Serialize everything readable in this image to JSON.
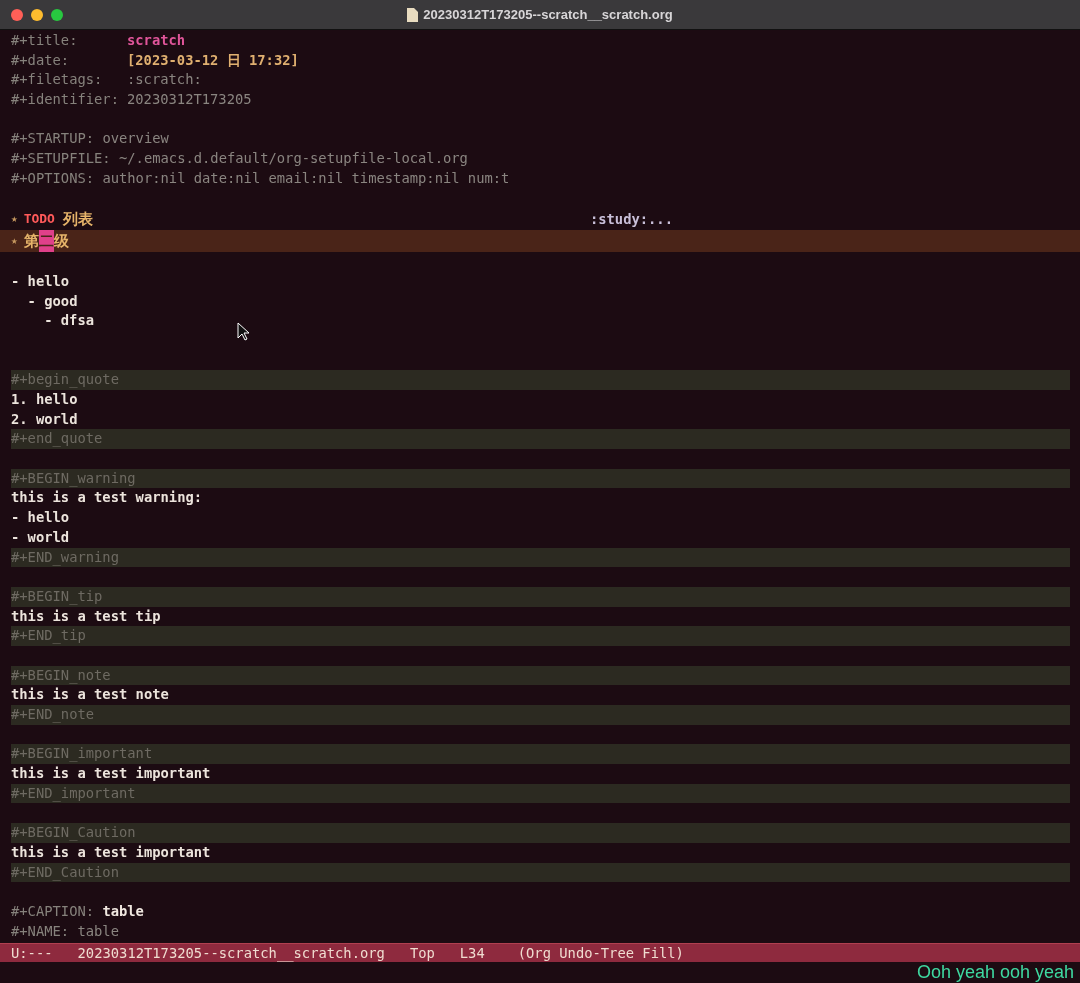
{
  "window": {
    "title": "20230312T173205--scratch__scratch.org"
  },
  "lines": [
    {
      "kind": "property",
      "key": "#+title:",
      "value": "scratch",
      "color": "#e0559a"
    },
    {
      "kind": "property",
      "key": "#+date:",
      "value": "[2023-03-12 日 17:32]",
      "color": "#e0b070"
    },
    {
      "kind": "property",
      "key": "#+filetags:",
      "value": ":scratch:",
      "color": "#8a8580"
    },
    {
      "kind": "property",
      "key": "#+identifier:",
      "value": "20230312T173205",
      "color": "#8a8580"
    },
    {
      "kind": "blank"
    },
    {
      "kind": "option",
      "key": "#+STARTUP:",
      "value": "overview",
      "color": "#8a8580"
    },
    {
      "kind": "option",
      "key": "#+SETUPFILE:",
      "value": "~/.emacs.d.default/org-setupfile-local.org",
      "color": "#8a8580"
    },
    {
      "kind": "option",
      "key": "#+OPTIONS:",
      "value": "author:nil date:nil email:nil timestamp:nil num:t",
      "color": "#8a8580"
    },
    {
      "kind": "blank"
    },
    {
      "kind": "heading",
      "star": "★",
      "todo": "TODO",
      "text": "列表",
      "tags": ":study:...",
      "current": false
    },
    {
      "kind": "heading",
      "star": "★",
      "text": "第",
      "cursor": "二",
      "rest": "级",
      "current": true
    },
    {
      "kind": "blank"
    },
    {
      "kind": "list",
      "items": [
        {
          "text": "- hello",
          "children": [
            {
              "text": "- good",
              "children": [
                {
                  "text": "- dfsa"
                }
              ]
            }
          ]
        }
      ]
    },
    {
      "kind": "blank"
    },
    {
      "kind": "blank"
    },
    {
      "kind": "block",
      "begin": "#+begin_quote",
      "body": [
        "1. hello",
        "2. world"
      ],
      "end": "#+end_quote"
    },
    {
      "kind": "blank"
    },
    {
      "kind": "block",
      "begin": "#+BEGIN_warning",
      "body": [
        "this is a test warning:",
        "- hello",
        "- world"
      ],
      "end": "#+END_warning"
    },
    {
      "kind": "blank"
    },
    {
      "kind": "block",
      "begin": "#+BEGIN_tip",
      "body": [
        "this is a test tip"
      ],
      "end": "#+END_tip"
    },
    {
      "kind": "blank"
    },
    {
      "kind": "block",
      "begin": "#+BEGIN_note",
      "body": [
        "this is a test note"
      ],
      "end": "#+END_note"
    },
    {
      "kind": "blank"
    },
    {
      "kind": "block",
      "begin": "#+BEGIN_important",
      "body": [
        "this is a test important"
      ],
      "end": "#+END_important"
    },
    {
      "kind": "blank"
    },
    {
      "kind": "block",
      "begin": "#+BEGIN_Caution",
      "body": [
        "this is a test important"
      ],
      "end": "#+END_Caution"
    },
    {
      "kind": "blank"
    },
    {
      "kind": "option",
      "key": "#+CAPTION:",
      "value": "table",
      "color": "#f0e8e0"
    },
    {
      "kind": "option",
      "key": "#+NAME:",
      "value": "table",
      "color": "#8a8580"
    }
  ],
  "mode_line": [
    "U:---",
    "20230312T173205--scratch__scratch.org",
    "Top",
    "L34",
    "(Org Undo-Tree Fill)"
  ],
  "echo": "Ooh yeah ooh yeah"
}
